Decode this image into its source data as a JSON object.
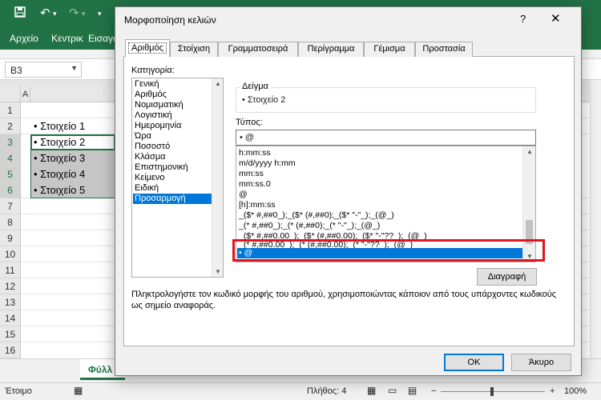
{
  "excel": {
    "ribbon_tabs": [
      "Αρχείο",
      "Κεντρικ",
      "Εισαγω"
    ],
    "name_box": "B3",
    "column_header": "A",
    "row_numbers": [
      "1",
      "2",
      "3",
      "4",
      "5",
      "6",
      "7",
      "8",
      "9",
      "10",
      "11",
      "12",
      "13",
      "14",
      "15",
      "16"
    ],
    "cells": [
      "• Στοιχείο 1",
      "• Στοιχείο 2",
      "• Στοιχείο 3",
      "• Στοιχείο 4",
      "• Στοιχείο 5"
    ],
    "sheet_tab": "Φύλλ",
    "status": {
      "ready": "Έτοιμο",
      "count": "Πλήθος: 4",
      "zoom": "100%"
    }
  },
  "dialog": {
    "title": "Μορφοποίηση κελιών",
    "help": "?",
    "close": "✕",
    "tabs": [
      "Αριθμός",
      "Στοίχιση",
      "Γραμματοσειρά",
      "Περίγραμμα",
      "Γέμισμα",
      "Προστασία"
    ],
    "category_label": "Κατηγορία:",
    "categories": [
      "Γενική",
      "Αριθμός",
      "Νομισματική",
      "Λογιστική",
      "Ημερομηνία",
      "Ώρα",
      "Ποσοστό",
      "Κλάσμα",
      "Επιστημονική",
      "Κείμενο",
      "Ειδική",
      "Προσαρμογή"
    ],
    "selected_category": "Προσαρμογή",
    "sample_label": "Δείγμα",
    "sample_value": "• Στοιχείο 2",
    "type_label": "Τύπος:",
    "type_value": "• @",
    "formats": [
      "h:mm:ss",
      "m/d/yyyy h:mm",
      "mm:ss",
      "mm:ss.0",
      "@",
      "[h]:mm:ss",
      "_($* #,##0_);_($* (#,##0);_($* \"-\"_);_(@_)",
      "_(* #,##0_);_(* (#,##0);_(* \"-\"_);_(@_)",
      "_($* #,##0.00_);_($* (#,##0.00);_($* \"-\"??_);_(@_)",
      "_(* #,##0.00_);_(* (#,##0.00);_(* \"-\"??_);_(@_)",
      "• @"
    ],
    "selected_format": "• @",
    "delete_button": "Διαγραφή",
    "description": "Πληκτρολογήστε τον κωδικό μορφής του αριθμού, χρησιμοποιώντας κάποιον από τους υπάρχοντες κωδικούς ως σημείο αναφοράς.",
    "ok_button": "OK",
    "cancel_button": "Άκυρο"
  },
  "colors": {
    "excel_green": "#217346",
    "selection_blue": "#0078d7",
    "highlight_red": "#e0141e"
  }
}
